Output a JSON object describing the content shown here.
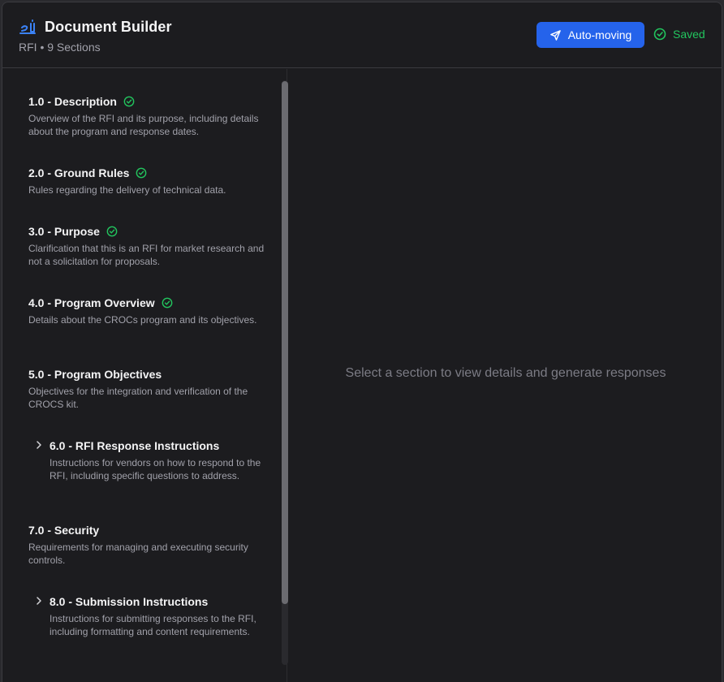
{
  "header": {
    "title": "Document Builder",
    "subtitle": "RFI • 9 Sections",
    "auto_label": "Auto-moving",
    "saved_label": "Saved",
    "accent_color": "#2563eb",
    "success_color": "#22c55e"
  },
  "sections": [
    {
      "title": "1.0 - Description",
      "desc": "Overview of the RFI and its purpose, including details about the program and response dates.",
      "complete": true
    },
    {
      "title": "2.0 - Ground Rules",
      "desc": "Rules regarding the delivery of technical data.",
      "complete": true
    },
    {
      "title": "3.0 - Purpose",
      "desc": "Clarification that this is an RFI for market research and not a solicitation for proposals.",
      "complete": true
    },
    {
      "title": "4.0 - Program Overview",
      "desc": "Details about the CROCs program and its objectives.",
      "complete": true
    },
    {
      "title": "5.0 - Program Objectives",
      "desc": "Objectives for the integration and verification of the CROCS kit.",
      "complete": false
    },
    {
      "title": "6.0 - RFI Response Instructions",
      "desc": "Instructions for vendors on how to respond to the RFI, including specific questions to address.",
      "complete": false,
      "expandable": true
    },
    {
      "title": "7.0 - Security",
      "desc": "Requirements for managing and executing security controls.",
      "complete": false
    },
    {
      "title": "8.0 - Submission Instructions",
      "desc": "Instructions for submitting responses to the RFI, including formatting and content requirements.",
      "complete": false,
      "expandable": true
    }
  ],
  "main": {
    "empty_message": "Select a section to view details and generate responses"
  }
}
